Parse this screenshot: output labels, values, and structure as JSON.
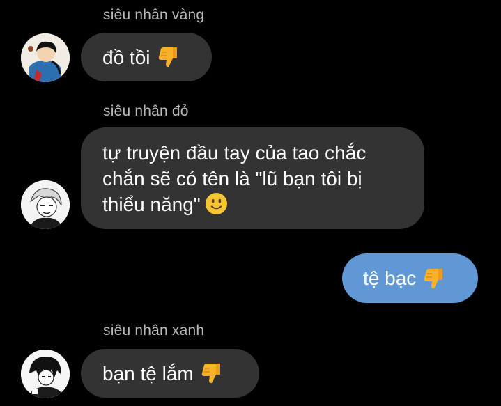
{
  "messages": [
    {
      "sender": "siêu nhân vàng",
      "text": "đồ tồi",
      "emoji": "thumbs-down-icon",
      "avatar": "avatar-yellow"
    },
    {
      "sender": "siêu nhân đỏ",
      "lines": [
        "tự truyện đầu tay của tao chắc",
        "chắn sẽ có tên là \"lũ bạn tôi bị",
        "thiểu năng\""
      ],
      "emoji": "slightly-smiling-face-icon",
      "avatar": "avatar-red"
    },
    {
      "sender": "me",
      "text": "tệ bạc",
      "emoji": "thumbs-down-icon",
      "outgoing": true
    },
    {
      "sender": "siêu nhân xanh",
      "text": "bạn tệ lắm",
      "emoji": "thumbs-down-icon",
      "avatar": "avatar-blue"
    }
  ],
  "colors": {
    "background": "#000000",
    "incoming_bubble": "#333333",
    "outgoing_bubble": "#5f98d4",
    "sender_name": "#b9b9b9",
    "message_text": "#ffffff",
    "emoji_yellow": "#f7b22a"
  }
}
